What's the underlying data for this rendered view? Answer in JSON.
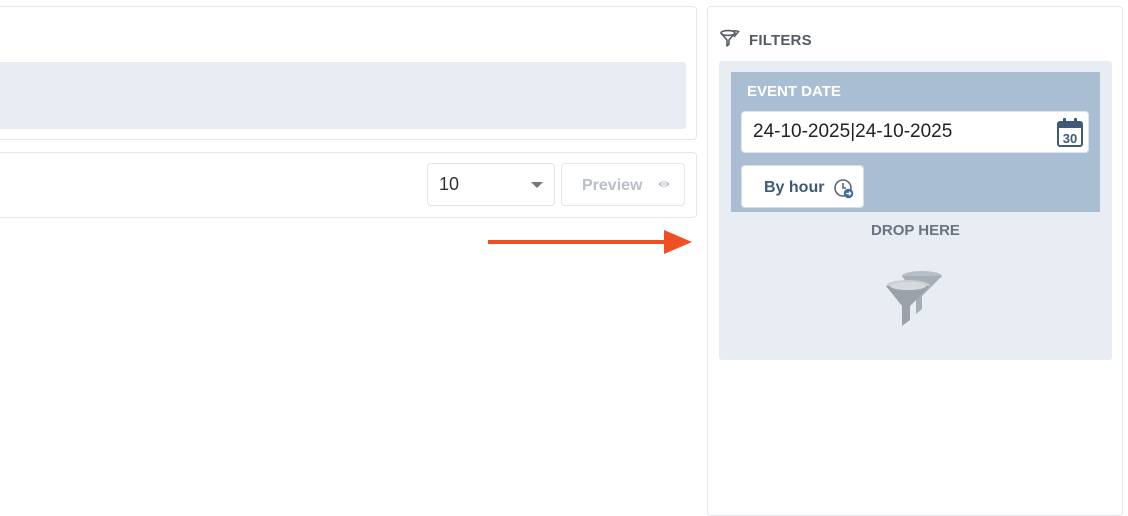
{
  "toolbar": {
    "rows_value": "10",
    "preview_label": "Preview"
  },
  "filters": {
    "title": "FILTERS",
    "event_date": {
      "label": "EVENT DATE",
      "value": "24-10-2025|24-10-2025",
      "granularity_label": "By hour"
    },
    "drop_label": "DROP HERE"
  },
  "colors": {
    "accent_arrow": "#f04e23",
    "filter_card": "#a9bdd3",
    "drop_area": "#e8edf4"
  },
  "icons": {
    "filters": "funnel-icon",
    "calendar": "calendar-icon",
    "eye": "eye-icon",
    "clock": "clock-icon",
    "drop": "funnel-stack-icon"
  }
}
